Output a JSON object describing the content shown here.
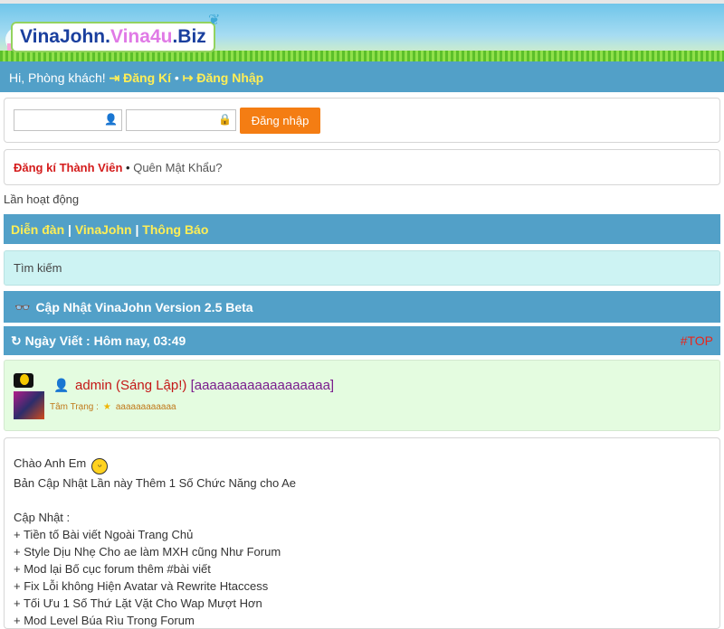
{
  "site": {
    "logo_part1": "VinaJohn.",
    "logo_part2": "Vina4u",
    "logo_part3": ".Biz"
  },
  "guest_bar": {
    "greeting": "Hi, Phòng khách!",
    "register": "Đăng Kí",
    "separator": "•",
    "login": "Đăng Nhập"
  },
  "login_form": {
    "username_value": "",
    "password_value": "",
    "submit_label": "Đăng nhập"
  },
  "register_links": {
    "register_member": "Đăng kí Thành Viên",
    "separator": "•",
    "forgot_password": "Quên Mật Khẩu?"
  },
  "last_active": "Lần hoạt động",
  "breadcrumb": {
    "items": [
      "Diễn đàn",
      "VinaJohn",
      "Thông Báo"
    ],
    "separator": "|"
  },
  "search": {
    "label": "Tìm kiếm"
  },
  "thread": {
    "title": "Cập Nhật VinaJohn Version 2.5 Beta",
    "date_label": "Ngày Viết : Hôm nay, 03:49",
    "top_link": "#TOP"
  },
  "author": {
    "name": "admin (Sáng Lập!)",
    "tag": "[aaaaaaaaaaaaaaaaaa]",
    "mood_label": "Tâm Trạng :",
    "mood_value": "aaaaaaaaaaaa"
  },
  "post": {
    "lines": [
      "Chào Anh Em",
      "Bản Cập Nhật Lần này Thêm 1 Số Chức Năng cho Ae",
      "",
      "Cập Nhật :",
      "+ Tiền tố Bài viết Ngoài Trang Chủ",
      "+ Style Dịu Nhẹ Cho ae làm MXH cũng Như Forum",
      "+ Mod lại Bố cục forum thêm #bài viết",
      "+ Fix Lỗi không Hiện Avatar và Rewrite Htaccess",
      "+ Tối Ưu 1 Số Thứ Lặt Vặt Cho Wap Mượt Hơn",
      "+ Mod Level Búa Rìu Trong Forum"
    ]
  },
  "colors": {
    "bar_blue": "#52a0c8",
    "link_yellow": "#ffee55",
    "button_orange": "#f47d13",
    "search_bg": "#cdf3f3",
    "user_bg": "#e4fce0"
  }
}
